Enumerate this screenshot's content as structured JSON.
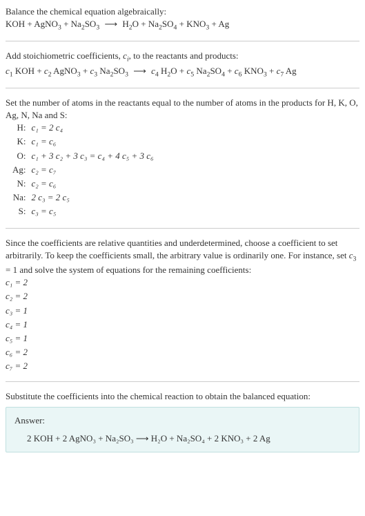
{
  "intro": {
    "line1": "Balance the chemical equation algebraically:",
    "eq_lhs": "KOH + AgNO",
    "eq_lhs2": " + Na",
    "eq_lhs3": "SO",
    "eq_rhs1": "H",
    "eq_rhs2": "O + Na",
    "eq_rhs3": "SO",
    "eq_rhs4": " + KNO",
    "eq_rhs5": " + Ag"
  },
  "step2": {
    "text": "Add stoichiometric coefficients, ",
    "ci": "c",
    "ci_sub": "i",
    "text2": ", to the reactants and products:",
    "terms": {
      "c1": "c",
      "s1": "1",
      "r1": " KOH + ",
      "c2": "c",
      "s2": "2",
      "r2": " AgNO",
      "r2b": " + ",
      "c3": "c",
      "s3": "3",
      "r3": " Na",
      "r3b": "SO",
      "c4": "c",
      "s4": "4",
      "r4": " H",
      "r4b": "O + ",
      "c5": "c",
      "s5": "5",
      "r5": " Na",
      "r5b": "SO",
      "r5c": " + ",
      "c6": "c",
      "s6": "6",
      "r6": " KNO",
      "r6b": " + ",
      "c7": "c",
      "s7": "7",
      "r7": " Ag"
    }
  },
  "step3": {
    "text": "Set the number of atoms in the reactants equal to the number of atoms in the products for H, K, O, Ag, N, Na and S:",
    "rows": [
      {
        "lbl": "H:",
        "eq": "c₁ = 2 c₄"
      },
      {
        "lbl": "K:",
        "eq": "c₁ = c₆"
      },
      {
        "lbl": "O:",
        "eq": "c₁ + 3 c₂ + 3 c₃ = c₄ + 4 c₅ + 3 c₆"
      },
      {
        "lbl": "Ag:",
        "eq": "c₂ = c₇"
      },
      {
        "lbl": "N:",
        "eq": "c₂ = c₆"
      },
      {
        "lbl": "Na:",
        "eq": "2 c₃ = 2 c₅"
      },
      {
        "lbl": "S:",
        "eq": "c₃ = c₅"
      }
    ]
  },
  "step4": {
    "text1": "Since the coefficients are relative quantities and underdetermined, choose a coefficient to set arbitrarily. To keep the coefficients small, the arbitrary value is ordinarily one. For instance, set ",
    "c3": "c",
    "c3s": "3",
    "text2": " = 1 and solve the system of equations for the remaining coefficients:",
    "coeffs": [
      "c₁ = 2",
      "c₂ = 2",
      "c₃ = 1",
      "c₄ = 1",
      "c₅ = 1",
      "c₆ = 2",
      "c₇ = 2"
    ]
  },
  "step5": {
    "text": "Substitute the coefficients into the chemical reaction to obtain the balanced equation:"
  },
  "answer": {
    "label": "Answer:",
    "eq": "2 KOH + 2 AgNO₃ + Na₂SO₃  ⟶  H₂O + Na₂SO₄ + 2 KNO₃ + 2 Ag"
  }
}
